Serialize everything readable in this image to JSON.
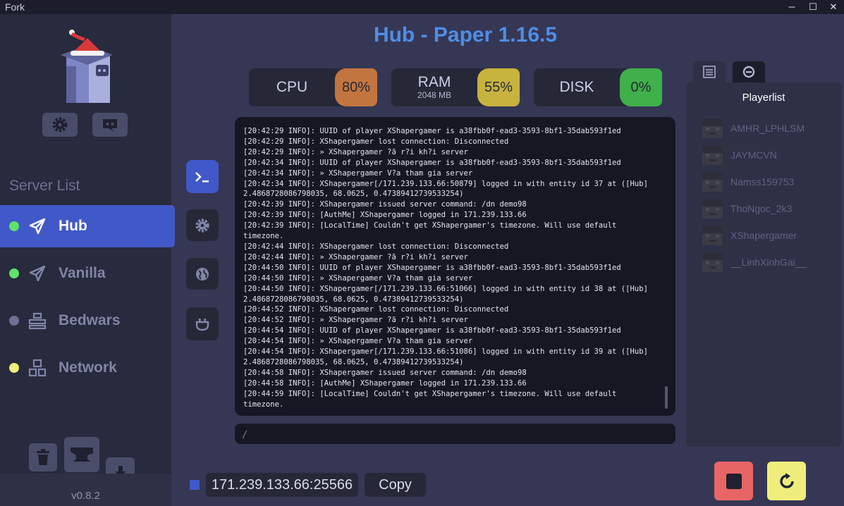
{
  "window": {
    "title": "Fork",
    "minimize": "─",
    "maximize": "☐",
    "close": "✕"
  },
  "sidebar": {
    "server_list_title": "Server List",
    "servers": [
      {
        "name": "Hub",
        "status_color": "#5fe36b",
        "active": true,
        "icon": "paper-plane-icon"
      },
      {
        "name": "Vanilla",
        "status_color": "#5fe36b",
        "active": false,
        "icon": "paper-plane-icon"
      },
      {
        "name": "Bedwars",
        "status_color": "#6d7194",
        "active": false,
        "icon": "proxy-icon"
      },
      {
        "name": "Network",
        "status_color": "#f0ec7c",
        "active": false,
        "icon": "network-icon"
      }
    ],
    "version": "v0.8.2"
  },
  "header": {
    "title": "Hub - Paper 1.16.5"
  },
  "stats": {
    "cpu": {
      "label": "CPU",
      "value": "80%",
      "color": "#c2753f"
    },
    "ram": {
      "label": "RAM",
      "sub": "2048 MB",
      "value": "55%",
      "color": "#c7b33e"
    },
    "disk": {
      "label": "DISK",
      "value": "0%",
      "color": "#3fb04a"
    }
  },
  "console": {
    "lines": [
      "[20:42:29 INFO]: UUID of player XShapergamer is a38fbb0f-ead3-3593-8bf1-35dab593f1ed",
      "[20:42:29 INFO]: XShapergamer lost connection: Disconnected",
      "[20:42:29 INFO]: » XShapergamer ?ã r?i kh?i server",
      "[20:42:34 INFO]: UUID of player XShapergamer is a38fbb0f-ead3-3593-8bf1-35dab593f1ed",
      "[20:42:34 INFO]: » XShapergamer V?a tham gia server",
      "[20:42:34 INFO]: XShapergamer[/171.239.133.66:50879] logged in with entity id 37 at ([Hub]",
      "2.4868728086798035, 68.0625, 0.47389412739533254)",
      "[20:42:39 INFO]: XShapergamer issued server command: /dn demo98",
      "[20:42:39 INFO]: [AuthMe] XShapergamer logged in 171.239.133.66",
      "[20:42:39 INFO]: [LocalTime] Couldn't get XShapergamer's timezone. Will use default",
      "timezone.",
      "[20:42:44 INFO]: XShapergamer lost connection: Disconnected",
      "[20:42:44 INFO]: » XShapergamer ?ã r?i kh?i server",
      "[20:44:50 INFO]: UUID of player XShapergamer is a38fbb0f-ead3-3593-8bf1-35dab593f1ed",
      "[20:44:50 INFO]: » XShapergamer V?a tham gia server",
      "[20:44:50 INFO]: XShapergamer[/171.239.133.66:51066] logged in with entity id 38 at ([Hub]",
      "2.4868728086798035, 68.0625, 0.47389412739533254)",
      "[20:44:52 INFO]: XShapergamer lost connection: Disconnected",
      "[20:44:52 INFO]: » XShapergamer ?ã r?i kh?i server",
      "[20:44:54 INFO]: UUID of player XShapergamer is a38fbb0f-ead3-3593-8bf1-35dab593f1ed",
      "[20:44:54 INFO]: » XShapergamer V?a tham gia server",
      "[20:44:54 INFO]: XShapergamer[/171.239.133.66:51086] logged in with entity id 39 at ([Hub]",
      "2.4868728086798035, 68.0625, 0.47389412739533254)",
      "[20:44:58 INFO]: XShapergamer issued server command: /dn demo98",
      "[20:44:58 INFO]: [AuthMe] XShapergamer logged in 171.239.133.66",
      "[20:44:59 INFO]: [LocalTime] Couldn't get XShapergamer's timezone. Will use default",
      "timezone."
    ],
    "command_placeholder": "/"
  },
  "playerlist": {
    "title": "Playerlist",
    "players": [
      "AMHR_LPHLSM",
      "JAYMCVN",
      "Namss159753",
      "ThoNgoc_2k3",
      "XShapergamer",
      "__LinhXinhGai__"
    ]
  },
  "footer": {
    "address": "171.239.133.66:25566",
    "copy_label": "Copy"
  }
}
